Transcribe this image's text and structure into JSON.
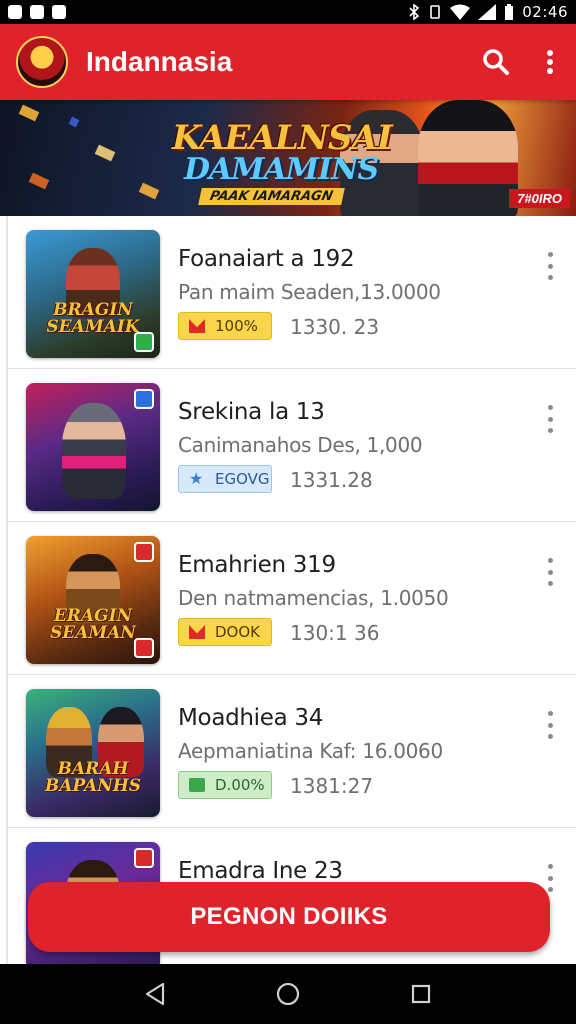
{
  "status_bar": {
    "time": "02:46"
  },
  "app_bar": {
    "title": "Indannasia",
    "color": "#e0232b"
  },
  "banner": {
    "title": "KAEALNSAI",
    "subtitle": "DAMAMINS",
    "tag": "PAAK IAMARAGN",
    "badge": "7#0IRO"
  },
  "list": {
    "items": [
      {
        "title": "Foanaiart a 192",
        "subtitle": "Pan maim Seaden,13.0000",
        "badge": "100%",
        "badge_style": "yellow",
        "meta": "1330. 23",
        "thumb_caption": "BRAGIN SEAMAIK"
      },
      {
        "title": "Srekina la 13",
        "subtitle": "Canimanahos Des, 1,000",
        "badge": "EGOVG",
        "badge_style": "blue",
        "meta": "1331.28",
        "thumb_caption": ""
      },
      {
        "title": "Emahrien 319",
        "subtitle": "Den natmamencias, 1.0050",
        "badge": "DOOK",
        "badge_style": "yellow",
        "meta": "130:1 36",
        "thumb_caption": "ERAGIN SEAMAN"
      },
      {
        "title": "Moadhiea 34",
        "subtitle": "Aepmaniatina Kaf: 16.0060",
        "badge": "D.00%",
        "badge_style": "green",
        "meta": "1381:27",
        "thumb_caption": "BARAH BAPANHS"
      },
      {
        "title": "Emadra Ine 23",
        "subtitle": "",
        "badge": "",
        "badge_style": "",
        "meta": "",
        "thumb_caption": ""
      }
    ]
  },
  "cta": {
    "label": "PEGNON DOIIKS"
  },
  "icons": {
    "search": "search-icon",
    "overflow": "more-vert-icon",
    "back": "back-triangle-icon",
    "home": "home-circle-icon",
    "recents": "recents-square-icon"
  }
}
